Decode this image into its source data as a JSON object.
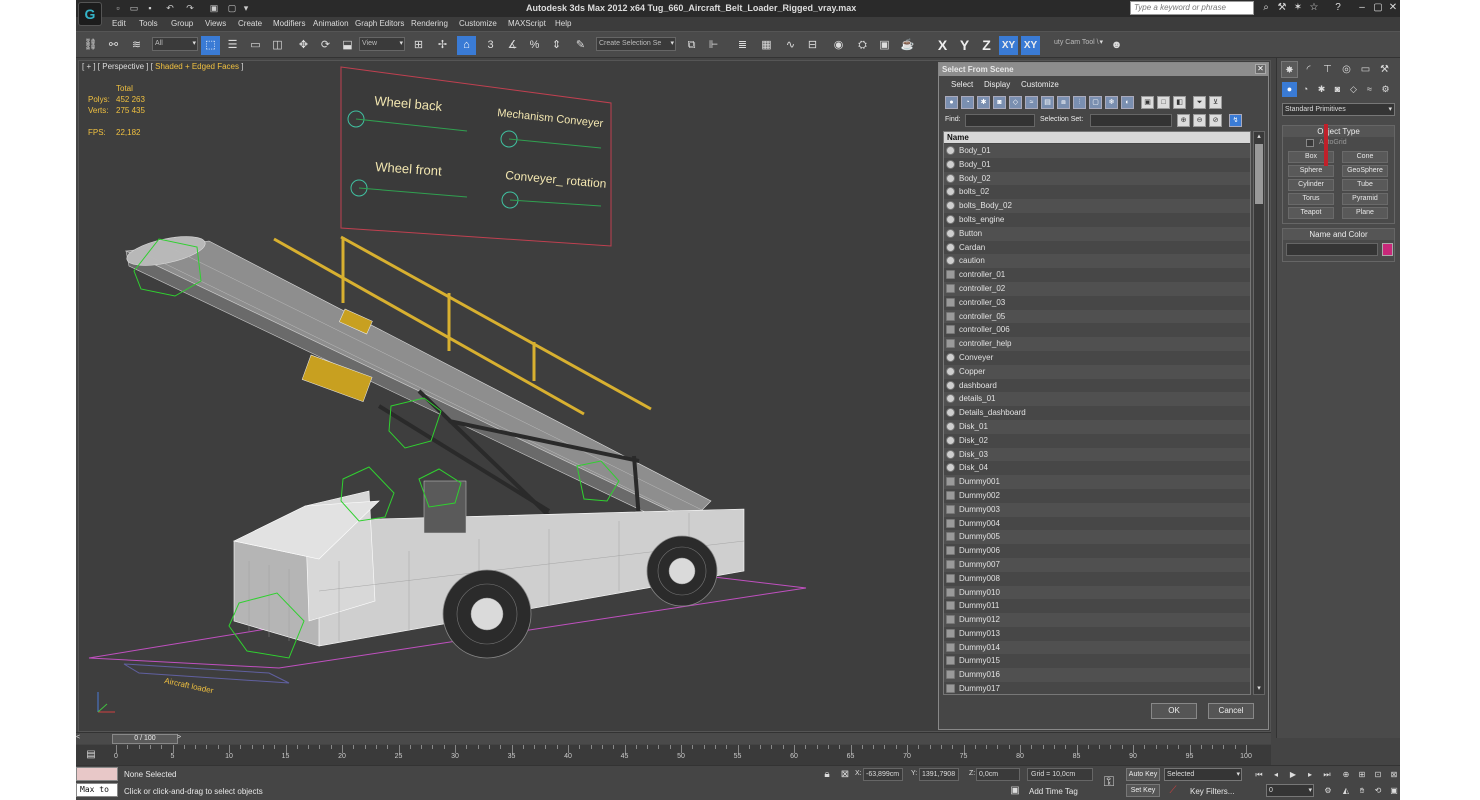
{
  "window": {
    "title": "Autodesk 3ds Max  2012 x64     Tug_660_Aircraft_Belt_Loader_Rigged_vray.max",
    "logo_glyph": "G",
    "help_search_placeholder": "Type a keyword or phrase"
  },
  "menu": [
    "Edit",
    "Tools",
    "Group",
    "Views",
    "Create",
    "Modifiers",
    "Animation",
    "Graph Editors",
    "Rendering",
    "Customize",
    "MAXScript",
    "Help"
  ],
  "toolbar": {
    "filter_dropdown": "All",
    "ref_coord_dropdown": "View",
    "named_selection_dropdown": "Create Selection Se",
    "axis_buttons": [
      "X",
      "Y",
      "Z",
      "XY",
      "XY"
    ],
    "active_axis": "XY",
    "extra_label": "uty Cam Tool \\",
    "snap_labels": [
      "3",
      "%"
    ]
  },
  "viewport": {
    "label_prefix": "[ + ] [ Perspective ] [ ",
    "label_shading": "Shaded + Edged Faces",
    "label_suffix": " ]",
    "stats": {
      "total_label": "Total",
      "polys_label": "Polys:",
      "polys_value": "452 263",
      "verts_label": "Verts:",
      "verts_value": "275 435",
      "fps_label": "FPS:",
      "fps_value": "22,182"
    },
    "rig_panel": {
      "wheel_back": "Wheel back",
      "mechanism_conveyer": "Mechanism Conveyer",
      "wheel_front": "Wheel front",
      "conveyer_rotation": "Conveyer_ rotation"
    },
    "ground_text": "Aircraft loader"
  },
  "select_dialog": {
    "title": "Select From Scene",
    "menu": [
      "Select",
      "Display",
      "Customize"
    ],
    "find_label": "Find:",
    "selection_set_label": "Selection Set:",
    "column_header": "Name",
    "ok_label": "OK",
    "cancel_label": "Cancel",
    "objects": [
      {
        "name": "Body_01",
        "type": "geometry"
      },
      {
        "name": "Body_01",
        "type": "geometry"
      },
      {
        "name": "Body_02",
        "type": "geometry"
      },
      {
        "name": "bolts_02",
        "type": "geometry"
      },
      {
        "name": "bolts_Body_02",
        "type": "geometry"
      },
      {
        "name": "bolts_engine",
        "type": "geometry"
      },
      {
        "name": "Button",
        "type": "geometry"
      },
      {
        "name": "Cardan",
        "type": "geometry"
      },
      {
        "name": "caution",
        "type": "geometry"
      },
      {
        "name": "controller_01",
        "type": "helper"
      },
      {
        "name": "controller_02",
        "type": "helper"
      },
      {
        "name": "controller_03",
        "type": "helper"
      },
      {
        "name": "controller_05",
        "type": "helper"
      },
      {
        "name": "controller_006",
        "type": "helper"
      },
      {
        "name": "controller_help",
        "type": "helper"
      },
      {
        "name": "Conveyer",
        "type": "geometry"
      },
      {
        "name": "Copper",
        "type": "geometry"
      },
      {
        "name": "dashboard",
        "type": "geometry"
      },
      {
        "name": "details_01",
        "type": "geometry"
      },
      {
        "name": "Details_dashboard",
        "type": "geometry"
      },
      {
        "name": "Disk_01",
        "type": "geometry"
      },
      {
        "name": "Disk_02",
        "type": "geometry"
      },
      {
        "name": "Disk_03",
        "type": "geometry"
      },
      {
        "name": "Disk_04",
        "type": "geometry"
      },
      {
        "name": "Dummy001",
        "type": "helper"
      },
      {
        "name": "Dummy002",
        "type": "helper"
      },
      {
        "name": "Dummy003",
        "type": "helper"
      },
      {
        "name": "Dummy004",
        "type": "helper"
      },
      {
        "name": "Dummy005",
        "type": "helper"
      },
      {
        "name": "Dummy006",
        "type": "helper"
      },
      {
        "name": "Dummy007",
        "type": "helper"
      },
      {
        "name": "Dummy008",
        "type": "helper"
      },
      {
        "name": "Dummy010",
        "type": "helper"
      },
      {
        "name": "Dummy011",
        "type": "helper"
      },
      {
        "name": "Dummy012",
        "type": "helper"
      },
      {
        "name": "Dummy013",
        "type": "helper"
      },
      {
        "name": "Dummy014",
        "type": "helper"
      },
      {
        "name": "Dummy015",
        "type": "helper"
      },
      {
        "name": "Dummy016",
        "type": "helper"
      },
      {
        "name": "Dummy017",
        "type": "helper"
      }
    ]
  },
  "command_panel": {
    "category_dropdown": "Standard Primitives",
    "object_type_title": "Object Type",
    "autogrid_label": "AutoGrid",
    "primitives": [
      "Box",
      "Cone",
      "Sphere",
      "GeoSphere",
      "Cylinder",
      "Tube",
      "Torus",
      "Pyramid",
      "Teapot",
      "Plane"
    ],
    "name_and_color_title": "Name and Color",
    "object_color": "#c8287a"
  },
  "timeline": {
    "frame_display": "0 / 100",
    "ticks": [
      "0",
      "5",
      "10",
      "15",
      "20",
      "25",
      "30",
      "35",
      "40",
      "45",
      "50",
      "55",
      "60",
      "65",
      "70",
      "75",
      "80",
      "85",
      "90",
      "95",
      "100"
    ]
  },
  "status": {
    "maxscript_label": "Max to",
    "selection_status": "None Selected",
    "prompt": "Click or click-and-drag to select objects",
    "x_label": "X:",
    "x_value": "-63,899cm",
    "y_label": "Y:",
    "y_value": "1391,7908",
    "z_label": "Z:",
    "z_value": "0,0cm",
    "grid": "Grid = 10,0cm",
    "add_time_tag": "Add Time Tag",
    "auto_key": "Auto Key",
    "set_key": "Set Key",
    "key_mode_dropdown": "Selected",
    "key_filters": "Key Filters...",
    "frame_field": "0"
  },
  "colors": {
    "active_blue": "#3a7bd5",
    "stat_yellow": "#f0c040",
    "rig_frame": "#c04050",
    "helper_green": "#30d030"
  }
}
